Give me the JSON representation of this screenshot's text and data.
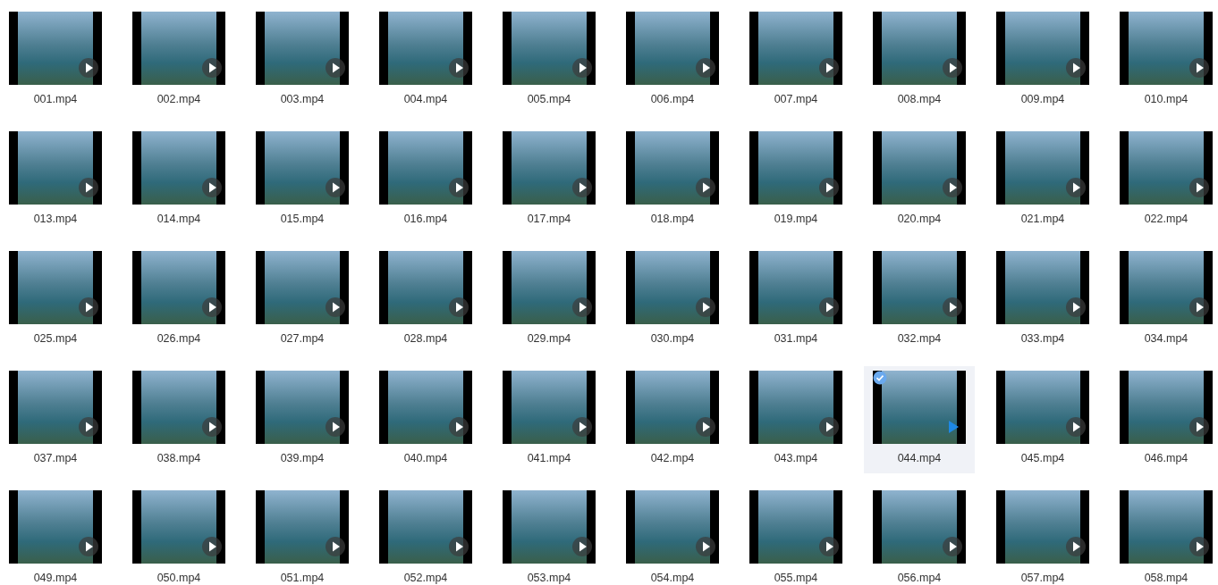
{
  "files": [
    {
      "name": "001.mp4",
      "selected": false
    },
    {
      "name": "002.mp4",
      "selected": false
    },
    {
      "name": "003.mp4",
      "selected": false
    },
    {
      "name": "004.mp4",
      "selected": false
    },
    {
      "name": "005.mp4",
      "selected": false
    },
    {
      "name": "006.mp4",
      "selected": false
    },
    {
      "name": "007.mp4",
      "selected": false
    },
    {
      "name": "008.mp4",
      "selected": false
    },
    {
      "name": "009.mp4",
      "selected": false
    },
    {
      "name": "010.mp4",
      "selected": false
    },
    {
      "name": "013.mp4",
      "selected": false
    },
    {
      "name": "014.mp4",
      "selected": false
    },
    {
      "name": "015.mp4",
      "selected": false
    },
    {
      "name": "016.mp4",
      "selected": false
    },
    {
      "name": "017.mp4",
      "selected": false
    },
    {
      "name": "018.mp4",
      "selected": false
    },
    {
      "name": "019.mp4",
      "selected": false
    },
    {
      "name": "020.mp4",
      "selected": false
    },
    {
      "name": "021.mp4",
      "selected": false
    },
    {
      "name": "022.mp4",
      "selected": false
    },
    {
      "name": "025.mp4",
      "selected": false
    },
    {
      "name": "026.mp4",
      "selected": false
    },
    {
      "name": "027.mp4",
      "selected": false
    },
    {
      "name": "028.mp4",
      "selected": false
    },
    {
      "name": "029.mp4",
      "selected": false
    },
    {
      "name": "030.mp4",
      "selected": false
    },
    {
      "name": "031.mp4",
      "selected": false
    },
    {
      "name": "032.mp4",
      "selected": false
    },
    {
      "name": "033.mp4",
      "selected": false
    },
    {
      "name": "034.mp4",
      "selected": false
    },
    {
      "name": "037.mp4",
      "selected": false
    },
    {
      "name": "038.mp4",
      "selected": false
    },
    {
      "name": "039.mp4",
      "selected": false
    },
    {
      "name": "040.mp4",
      "selected": false
    },
    {
      "name": "041.mp4",
      "selected": false
    },
    {
      "name": "042.mp4",
      "selected": false
    },
    {
      "name": "043.mp4",
      "selected": false
    },
    {
      "name": "044.mp4",
      "selected": true
    },
    {
      "name": "045.mp4",
      "selected": false
    },
    {
      "name": "046.mp4",
      "selected": false
    },
    {
      "name": "049.mp4",
      "selected": false
    },
    {
      "name": "050.mp4",
      "selected": false
    },
    {
      "name": "051.mp4",
      "selected": false
    },
    {
      "name": "052.mp4",
      "selected": false
    },
    {
      "name": "053.mp4",
      "selected": false
    },
    {
      "name": "054.mp4",
      "selected": false
    },
    {
      "name": "055.mp4",
      "selected": false
    },
    {
      "name": "056.mp4",
      "selected": false
    },
    {
      "name": "057.mp4",
      "selected": false
    },
    {
      "name": "058.mp4",
      "selected": false
    }
  ]
}
